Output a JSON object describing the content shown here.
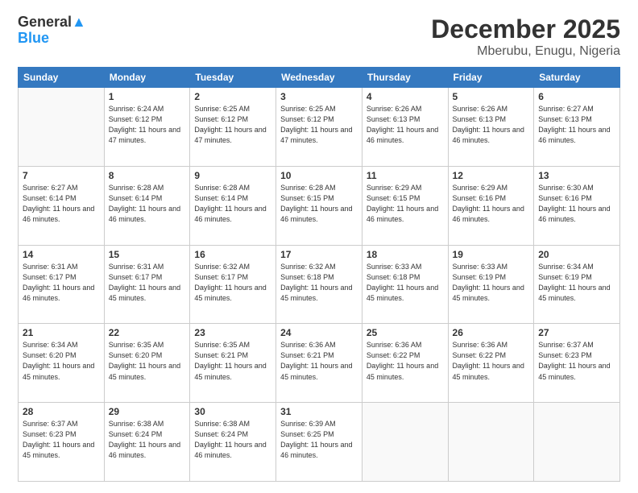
{
  "logo": {
    "line1": "General",
    "line2": "Blue"
  },
  "title": "December 2025",
  "subtitle": "Mberubu, Enugu, Nigeria",
  "days_of_week": [
    "Sunday",
    "Monday",
    "Tuesday",
    "Wednesday",
    "Thursday",
    "Friday",
    "Saturday"
  ],
  "weeks": [
    [
      {
        "day": "",
        "sunrise": "",
        "sunset": "",
        "daylight": "",
        "empty": true
      },
      {
        "day": "1",
        "sunrise": "6:24 AM",
        "sunset": "6:12 PM",
        "daylight": "11 hours and 47 minutes."
      },
      {
        "day": "2",
        "sunrise": "6:25 AM",
        "sunset": "6:12 PM",
        "daylight": "11 hours and 47 minutes."
      },
      {
        "day": "3",
        "sunrise": "6:25 AM",
        "sunset": "6:12 PM",
        "daylight": "11 hours and 47 minutes."
      },
      {
        "day": "4",
        "sunrise": "6:26 AM",
        "sunset": "6:13 PM",
        "daylight": "11 hours and 46 minutes."
      },
      {
        "day": "5",
        "sunrise": "6:26 AM",
        "sunset": "6:13 PM",
        "daylight": "11 hours and 46 minutes."
      },
      {
        "day": "6",
        "sunrise": "6:27 AM",
        "sunset": "6:13 PM",
        "daylight": "11 hours and 46 minutes."
      }
    ],
    [
      {
        "day": "7",
        "sunrise": "6:27 AM",
        "sunset": "6:14 PM",
        "daylight": "11 hours and 46 minutes."
      },
      {
        "day": "8",
        "sunrise": "6:28 AM",
        "sunset": "6:14 PM",
        "daylight": "11 hours and 46 minutes."
      },
      {
        "day": "9",
        "sunrise": "6:28 AM",
        "sunset": "6:14 PM",
        "daylight": "11 hours and 46 minutes."
      },
      {
        "day": "10",
        "sunrise": "6:28 AM",
        "sunset": "6:15 PM",
        "daylight": "11 hours and 46 minutes."
      },
      {
        "day": "11",
        "sunrise": "6:29 AM",
        "sunset": "6:15 PM",
        "daylight": "11 hours and 46 minutes."
      },
      {
        "day": "12",
        "sunrise": "6:29 AM",
        "sunset": "6:16 PM",
        "daylight": "11 hours and 46 minutes."
      },
      {
        "day": "13",
        "sunrise": "6:30 AM",
        "sunset": "6:16 PM",
        "daylight": "11 hours and 46 minutes."
      }
    ],
    [
      {
        "day": "14",
        "sunrise": "6:31 AM",
        "sunset": "6:17 PM",
        "daylight": "11 hours and 46 minutes."
      },
      {
        "day": "15",
        "sunrise": "6:31 AM",
        "sunset": "6:17 PM",
        "daylight": "11 hours and 45 minutes."
      },
      {
        "day": "16",
        "sunrise": "6:32 AM",
        "sunset": "6:17 PM",
        "daylight": "11 hours and 45 minutes."
      },
      {
        "day": "17",
        "sunrise": "6:32 AM",
        "sunset": "6:18 PM",
        "daylight": "11 hours and 45 minutes."
      },
      {
        "day": "18",
        "sunrise": "6:33 AM",
        "sunset": "6:18 PM",
        "daylight": "11 hours and 45 minutes."
      },
      {
        "day": "19",
        "sunrise": "6:33 AM",
        "sunset": "6:19 PM",
        "daylight": "11 hours and 45 minutes."
      },
      {
        "day": "20",
        "sunrise": "6:34 AM",
        "sunset": "6:19 PM",
        "daylight": "11 hours and 45 minutes."
      }
    ],
    [
      {
        "day": "21",
        "sunrise": "6:34 AM",
        "sunset": "6:20 PM",
        "daylight": "11 hours and 45 minutes."
      },
      {
        "day": "22",
        "sunrise": "6:35 AM",
        "sunset": "6:20 PM",
        "daylight": "11 hours and 45 minutes."
      },
      {
        "day": "23",
        "sunrise": "6:35 AM",
        "sunset": "6:21 PM",
        "daylight": "11 hours and 45 minutes."
      },
      {
        "day": "24",
        "sunrise": "6:36 AM",
        "sunset": "6:21 PM",
        "daylight": "11 hours and 45 minutes."
      },
      {
        "day": "25",
        "sunrise": "6:36 AM",
        "sunset": "6:22 PM",
        "daylight": "11 hours and 45 minutes."
      },
      {
        "day": "26",
        "sunrise": "6:36 AM",
        "sunset": "6:22 PM",
        "daylight": "11 hours and 45 minutes."
      },
      {
        "day": "27",
        "sunrise": "6:37 AM",
        "sunset": "6:23 PM",
        "daylight": "11 hours and 45 minutes."
      }
    ],
    [
      {
        "day": "28",
        "sunrise": "6:37 AM",
        "sunset": "6:23 PM",
        "daylight": "11 hours and 45 minutes."
      },
      {
        "day": "29",
        "sunrise": "6:38 AM",
        "sunset": "6:24 PM",
        "daylight": "11 hours and 46 minutes."
      },
      {
        "day": "30",
        "sunrise": "6:38 AM",
        "sunset": "6:24 PM",
        "daylight": "11 hours and 46 minutes."
      },
      {
        "day": "31",
        "sunrise": "6:39 AM",
        "sunset": "6:25 PM",
        "daylight": "11 hours and 46 minutes."
      },
      {
        "day": "",
        "empty": true
      },
      {
        "day": "",
        "empty": true
      },
      {
        "day": "",
        "empty": true
      }
    ]
  ]
}
